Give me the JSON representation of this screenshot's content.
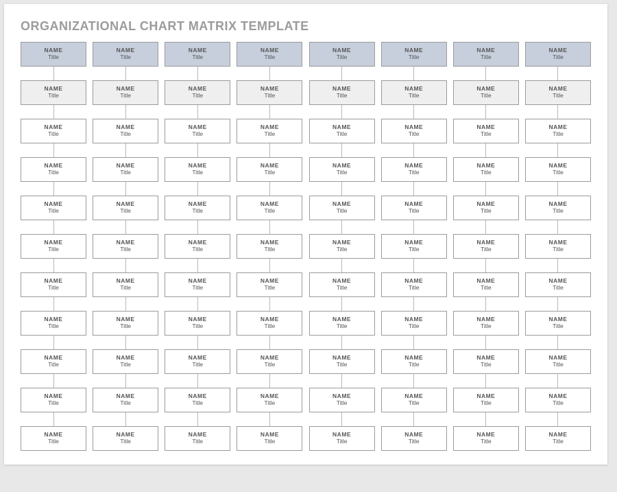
{
  "heading": "ORGANIZATIONAL CHART MATRIX TEMPLATE",
  "labels": {
    "name": "NAME",
    "title": "Title"
  },
  "columns": 8,
  "rows": 11
}
